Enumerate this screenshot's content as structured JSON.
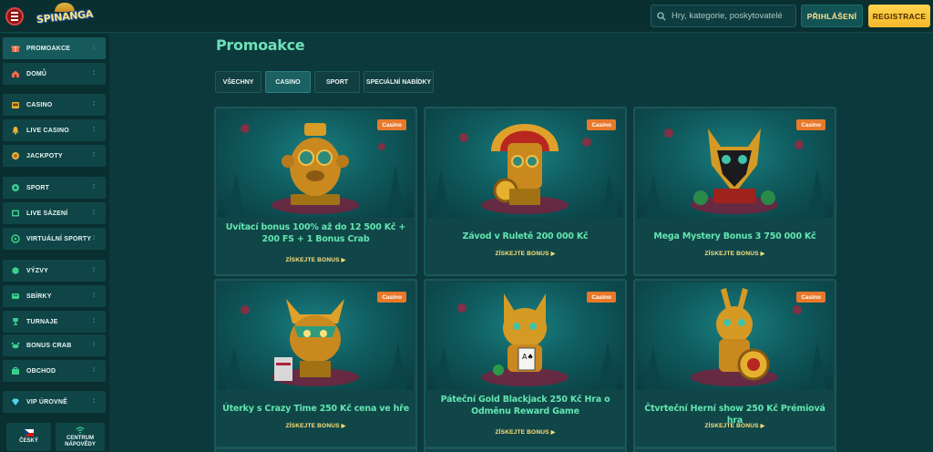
{
  "header": {
    "logo_text": "SPINANGA",
    "search_placeholder": "Hry, kategorie, poskytovatelé",
    "login_label": "PŘIHLÁŠENÍ",
    "register_label": "REGISTRACE"
  },
  "sidebar": {
    "items": [
      {
        "label": "PROMOAKCE",
        "icon": "gift-icon",
        "active": true
      },
      {
        "label": "DOMŮ",
        "icon": "home-icon"
      },
      {
        "label": "CASINO",
        "icon": "slot-machine-icon"
      },
      {
        "label": "LIVE CASINO",
        "icon": "bell-icon"
      },
      {
        "label": "JACKPOTY",
        "icon": "jackpot-icon"
      },
      {
        "label": "SPORT",
        "icon": "football-icon"
      },
      {
        "label": "LIVE SÁZENÍ",
        "icon": "live-betting-icon"
      },
      {
        "label": "VIRTUÁLNÍ SPORTY",
        "icon": "virtual-sport-icon"
      },
      {
        "label": "VÝZVY",
        "icon": "challenge-icon"
      },
      {
        "label": "SBÍRKY",
        "icon": "collection-icon"
      },
      {
        "label": "TURNAJE",
        "icon": "trophy-icon"
      },
      {
        "label": "BONUS CRAB",
        "icon": "crab-icon"
      },
      {
        "label": "OBCHOD",
        "icon": "shop-icon"
      },
      {
        "label": "VIP ÚROVNĚ",
        "icon": "diamond-icon"
      }
    ],
    "language_label": "ČESKÝ",
    "help_label_1": "CENTRUM",
    "help_label_2": "NÁPOVĚDY"
  },
  "main": {
    "title": "Promoakce",
    "tabs": [
      {
        "label": "VŠECHNY"
      },
      {
        "label": "CASINO",
        "active": true
      },
      {
        "label": "SPORT"
      },
      {
        "label": "SPECIÁLNÍ NABÍDKY"
      }
    ],
    "cards": [
      {
        "badge": "Casino",
        "title": "Uvítací bonus 100% až do 12 500 Kč + 200 FS + 1 Bonus Crab",
        "link": "ZÍSKEJTE BONUS",
        "art": "monkey-idol"
      },
      {
        "badge": "Casino",
        "title": "Závod v Ruletě 200 000 Kč",
        "link": "ZÍSKEJTE BONUS",
        "art": "sun-priest"
      },
      {
        "badge": "Casino",
        "title": "Mega Mystery Bonus 3 750 000 Kč",
        "link": "ZÍSKEJTE BONUS",
        "art": "jaguar-mask"
      },
      {
        "badge": "Casino",
        "title": "Úterky s Crazy Time 250 Kč cena ve hře",
        "link": "ZÍSKEJTE BONUS",
        "art": "bull-idol"
      },
      {
        "badge": "Casino",
        "title": "Páteční Gold Blackjack 250 Kč Hra o Odměnu Reward Game",
        "link": "ZÍSKEJTE BONUS",
        "art": "cat-idol"
      },
      {
        "badge": "Casino",
        "title": "Čtvrteční Herní show 250 Kč Prémiová hra",
        "link": "ZÍSKEJTE BONUS",
        "art": "llama-idol"
      }
    ]
  },
  "colors": {
    "background": "#0c3a3c",
    "accent_green": "#62e6b0",
    "accent_yellow": "#ffe27a",
    "badge_orange": "#e8782a",
    "register_yellow": "#f5b72b"
  }
}
